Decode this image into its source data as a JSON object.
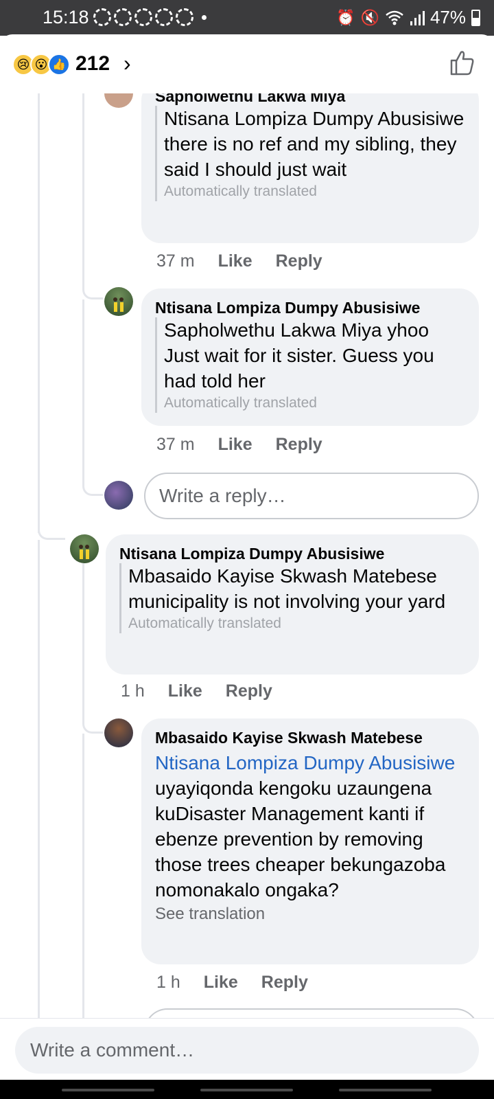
{
  "status_bar": {
    "time": "15:18",
    "battery": "47%",
    "icons": [
      "alarm-icon",
      "mute-icon",
      "wifi-icon",
      "signal-icon",
      "battery-icon"
    ]
  },
  "reactions": {
    "emojis": [
      "sad-emoji",
      "wow-emoji",
      "like-emoji"
    ],
    "count": "212"
  },
  "comments": [
    {
      "author": "Sapholwethu Lakwa Miya",
      "text": "Ntisana Lompiza Dumpy Abusisiwe there is no ref and my sibling, they said I should just wait",
      "translation_note": "Automatically translated",
      "time": "37 m",
      "like": "Like",
      "reply": "Reply"
    },
    {
      "author": "Ntisana Lompiza Dumpy Abusisiwe",
      "text": "Sapholwethu Lakwa Miya yhoo Just wait for it sister. Guess you had told her",
      "translation_note": "Automatically translated",
      "time": "37 m",
      "like": "Like",
      "reply": "Reply"
    },
    {
      "author": "Ntisana Lompiza Dumpy Abusisiwe",
      "text": "Mbasaido Kayise Skwash Matebese municipality is not involving your yard",
      "translation_note": "Automatically translated",
      "time": "1 h",
      "like": "Like",
      "reply": "Reply"
    },
    {
      "author": "Mbasaido Kayise Skwash Matebese",
      "mention": "Ntisana Lompiza Dumpy Abusisiwe",
      "text": " uyayiqonda kengoku uzaungena kuDisaster Management kanti if ebenze prevention by removing those trees cheaper bekungazoba nomonakalo ongaka?",
      "translation_note": "See translation",
      "time": "1 h",
      "like": "Like",
      "reply": "Reply"
    }
  ],
  "reply_input": {
    "placeholder": "Write a reply…"
  },
  "composer": {
    "placeholder": "Write a comment…"
  },
  "colors": {
    "accent": "#1b74e4",
    "mention": "#2366c4",
    "bubble": "#f0f2f5",
    "meta": "#65676b"
  }
}
